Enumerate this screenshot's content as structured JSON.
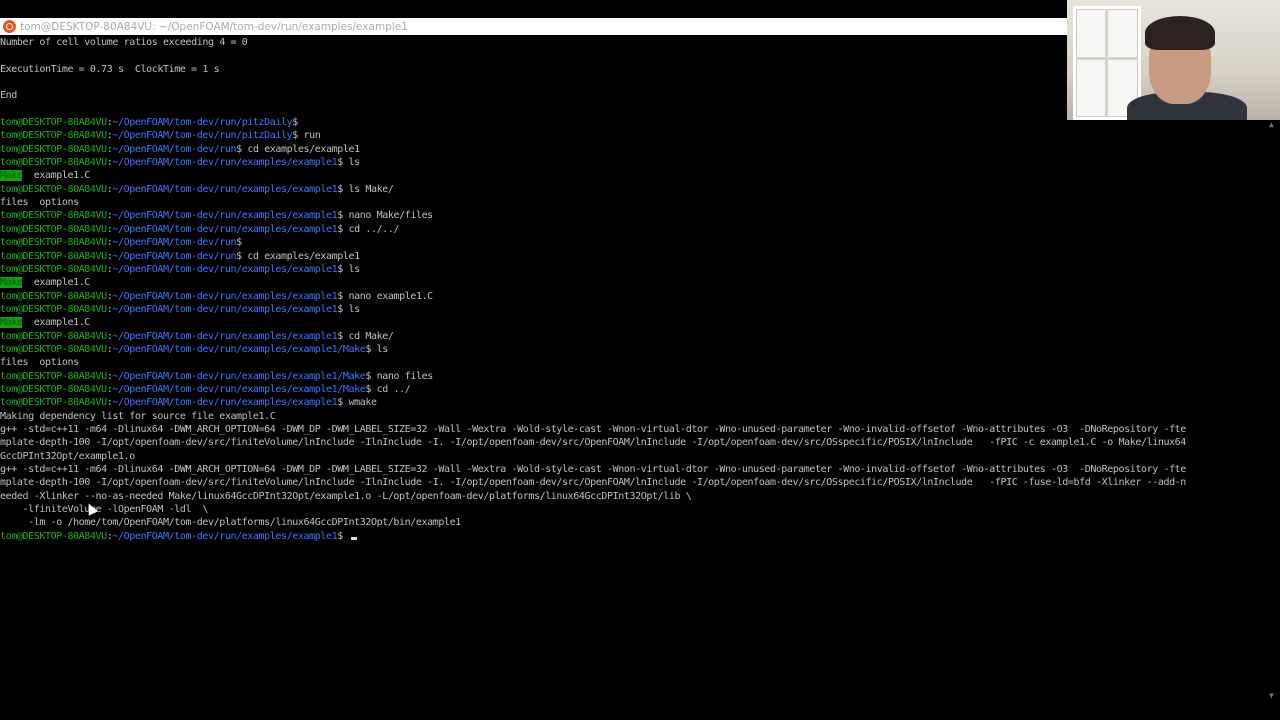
{
  "window": {
    "title": "tom@DESKTOP-80A84VU: ~/OpenFOAM/tom-dev/run/examples/example1",
    "app_icon": "ubuntu-icon"
  },
  "colors": {
    "background": "#000000",
    "text": "#c0c0c0",
    "user": "#17b317",
    "path": "#3b78ff",
    "dir_highlight": "#13a10e"
  },
  "terminal": {
    "prompt_user": "tom@DESKTOP-80A84VU",
    "lines": [
      {
        "t": "out",
        "text": "Number of cell volume ratios exceeding 4 = 0"
      },
      {
        "t": "out",
        "text": ""
      },
      {
        "t": "out",
        "text": "ExecutionTime = 0.73 s  ClockTime = 1 s"
      },
      {
        "t": "out",
        "text": ""
      },
      {
        "t": "out",
        "text": "End"
      },
      {
        "t": "out",
        "text": ""
      },
      {
        "t": "prompt",
        "path": "~/OpenFOAM/tom-dev/run/pitzDaily",
        "cmd": ""
      },
      {
        "t": "prompt",
        "path": "~/OpenFOAM/tom-dev/run/pitzDaily",
        "cmd": "run"
      },
      {
        "t": "prompt",
        "path": "~/OpenFOAM/tom-dev/run",
        "cmd": "cd examples/example1"
      },
      {
        "t": "prompt",
        "path": "~/OpenFOAM/tom-dev/run/examples/example1",
        "cmd": "ls"
      },
      {
        "t": "ls",
        "dir": "Make",
        "rest": "  example1.C"
      },
      {
        "t": "prompt",
        "path": "~/OpenFOAM/tom-dev/run/examples/example1",
        "cmd": "ls Make/"
      },
      {
        "t": "out",
        "text": "files  options"
      },
      {
        "t": "prompt",
        "path": "~/OpenFOAM/tom-dev/run/examples/example1",
        "cmd": "nano Make/files"
      },
      {
        "t": "prompt",
        "path": "~/OpenFOAM/tom-dev/run/examples/example1",
        "cmd": "cd ../../"
      },
      {
        "t": "prompt",
        "path": "~/OpenFOAM/tom-dev/run",
        "cmd": ""
      },
      {
        "t": "prompt",
        "path": "~/OpenFOAM/tom-dev/run",
        "cmd": "cd examples/example1"
      },
      {
        "t": "prompt",
        "path": "~/OpenFOAM/tom-dev/run/examples/example1",
        "cmd": "ls"
      },
      {
        "t": "ls",
        "dir": "Make",
        "rest": "  example1.C"
      },
      {
        "t": "prompt",
        "path": "~/OpenFOAM/tom-dev/run/examples/example1",
        "cmd": "nano example1.C"
      },
      {
        "t": "prompt",
        "path": "~/OpenFOAM/tom-dev/run/examples/example1",
        "cmd": "ls"
      },
      {
        "t": "ls",
        "dir": "Make",
        "rest": "  example1.C"
      },
      {
        "t": "prompt",
        "path": "~/OpenFOAM/tom-dev/run/examples/example1",
        "cmd": "cd Make/"
      },
      {
        "t": "prompt",
        "path": "~/OpenFOAM/tom-dev/run/examples/example1/Make",
        "cmd": "ls"
      },
      {
        "t": "out",
        "text": "files  options"
      },
      {
        "t": "prompt",
        "path": "~/OpenFOAM/tom-dev/run/examples/example1/Make",
        "cmd": "nano files"
      },
      {
        "t": "prompt",
        "path": "~/OpenFOAM/tom-dev/run/examples/example1/Make",
        "cmd": "cd ../"
      },
      {
        "t": "prompt",
        "path": "~/OpenFOAM/tom-dev/run/examples/example1",
        "cmd": "wmake"
      },
      {
        "t": "out",
        "text": "Making dependency list for source file example1.C"
      },
      {
        "t": "out",
        "text": "g++ -std=c++11 -m64 -Dlinux64 -DWM_ARCH_OPTION=64 -DWM_DP -DWM_LABEL_SIZE=32 -Wall -Wextra -Wold-style-cast -Wnon-virtual-dtor -Wno-unused-parameter -Wno-invalid-offsetof -Wno-attributes -O3  -DNoRepository -fte"
      },
      {
        "t": "out",
        "text": "mplate-depth-100 -I/opt/openfoam-dev/src/finiteVolume/lnInclude -IlnInclude -I. -I/opt/openfoam-dev/src/OpenFOAM/lnInclude -I/opt/openfoam-dev/src/OSspecific/POSIX/lnInclude   -fPIC -c example1.C -o Make/linux64"
      },
      {
        "t": "out",
        "text": "GccDPInt32Opt/example1.o"
      },
      {
        "t": "out",
        "text": "g++ -std=c++11 -m64 -Dlinux64 -DWM_ARCH_OPTION=64 -DWM_DP -DWM_LABEL_SIZE=32 -Wall -Wextra -Wold-style-cast -Wnon-virtual-dtor -Wno-unused-parameter -Wno-invalid-offsetof -Wno-attributes -O3  -DNoRepository -fte"
      },
      {
        "t": "out",
        "text": "mplate-depth-100 -I/opt/openfoam-dev/src/finiteVolume/lnInclude -IlnInclude -I. -I/opt/openfoam-dev/src/OpenFOAM/lnInclude -I/opt/openfoam-dev/src/OSspecific/POSIX/lnInclude   -fPIC -fuse-ld=bfd -Xlinker --add-n"
      },
      {
        "t": "out",
        "text": "eeded -Xlinker --no-as-needed Make/linux64GccDPInt32Opt/example1.o -L/opt/openfoam-dev/platforms/linux64GccDPInt32Opt/lib \\"
      },
      {
        "t": "out",
        "text": "    -lfiniteVolume -lOpenFOAM -ldl  \\"
      },
      {
        "t": "out",
        "text": "     -lm -o /home/tom/OpenFOAM/tom-dev/platforms/linux64GccDPInt32Opt/bin/example1"
      },
      {
        "t": "prompt",
        "path": "~/OpenFOAM/tom-dev/run/examples/example1",
        "cmd": "",
        "cursor": true
      }
    ]
  },
  "scrollbar": {
    "up_icon": "triangle-up-icon",
    "down_icon": "triangle-down-icon"
  },
  "webcam": {
    "subject": "presenter-webcam-overlay"
  }
}
